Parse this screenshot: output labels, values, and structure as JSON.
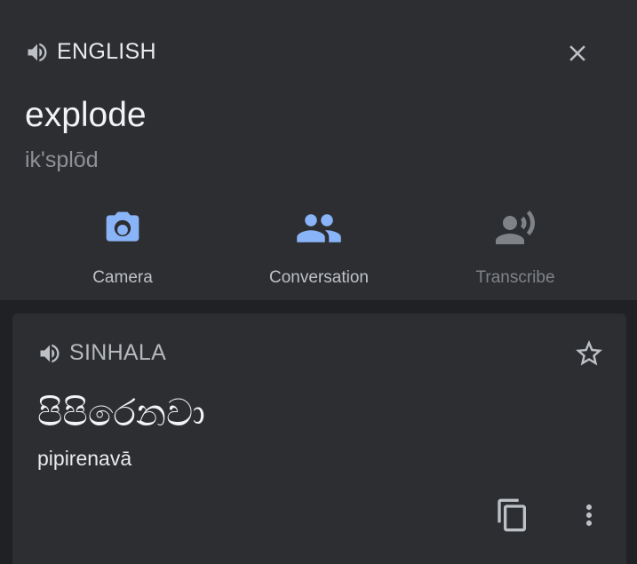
{
  "source": {
    "language": "ENGLISH",
    "text": "explode",
    "transliteration": "ik'splōd"
  },
  "tools": [
    {
      "label": "Camera",
      "icon": "camera-icon"
    },
    {
      "label": "Conversation",
      "icon": "conversation-icon"
    },
    {
      "label": "Transcribe",
      "icon": "transcribe-icon"
    }
  ],
  "target": {
    "language": "SINHALA",
    "text": "පිපිරෙනවා",
    "transliteration": "pipirenavā"
  },
  "colors": {
    "accent": "#8ab4f8",
    "background": "#202124",
    "panel": "#2d2e31",
    "disabled": "#7f8388"
  }
}
